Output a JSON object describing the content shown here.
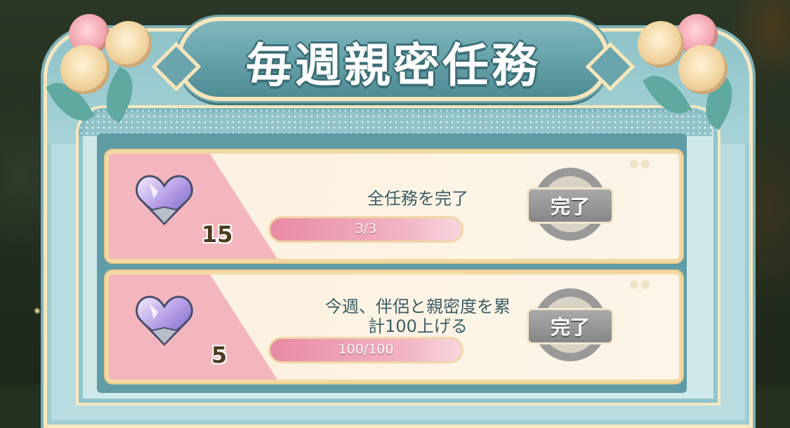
{
  "title": "毎週親密任務",
  "tasks": [
    {
      "description": "全任務を完了",
      "reward_count": "15",
      "progress_text": "3/3",
      "progress_fraction": 1.0,
      "status_label": "完了",
      "reward_icon": "crystal-heart-icon"
    },
    {
      "description_line1": "今週、伴侶と親密度を累",
      "description_line2": "計100上げる",
      "reward_count": "5",
      "progress_text": "100/100",
      "progress_fraction": 1.0,
      "status_label": "完了",
      "reward_icon": "crystal-heart-icon"
    }
  ],
  "colors": {
    "panel": "#b9dce0",
    "banner": "#5f9aa2",
    "card_pink": "#f4b6be",
    "progress_fill": "#e88aa4",
    "done_button": "#999999"
  }
}
